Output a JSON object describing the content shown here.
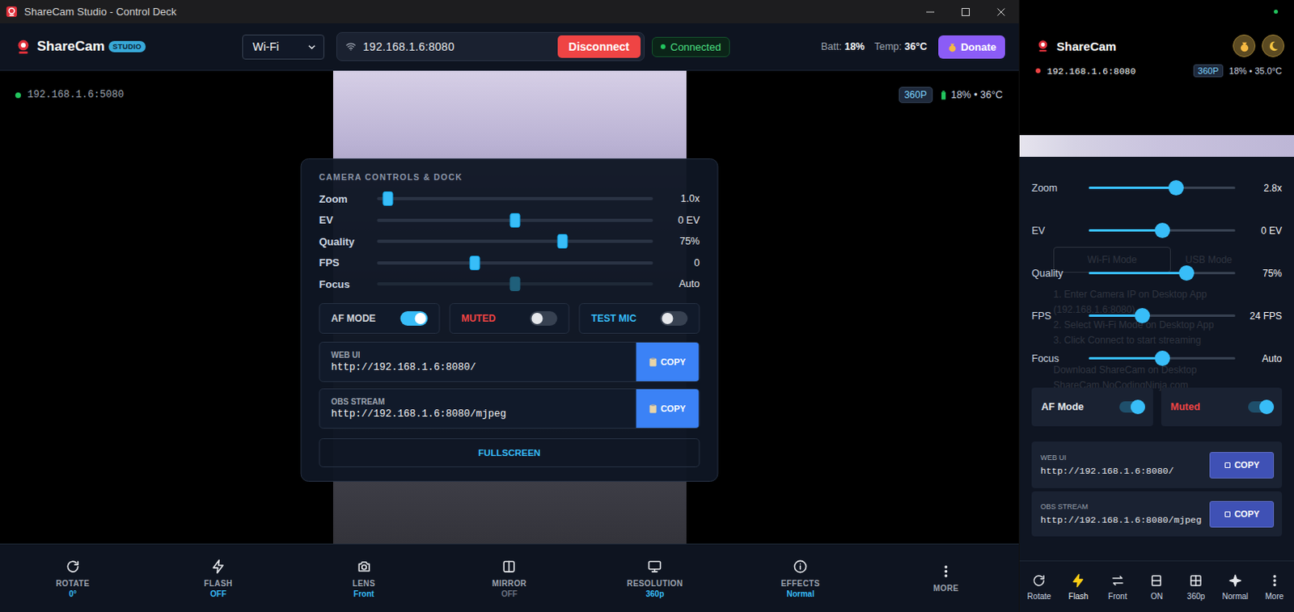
{
  "window": {
    "title": "ShareCam Studio - Control Deck"
  },
  "header": {
    "brand": "ShareCam",
    "badge": "STUDIO",
    "connection_type": "Wi-Fi",
    "address": "192.168.1.6:8080",
    "disconnect": "Disconnect",
    "status": "Connected",
    "battery_label": "Batt:",
    "battery": "18%",
    "temp_label": "Temp:",
    "temp": "36°C",
    "donate": "Donate"
  },
  "preview": {
    "source": "192.168.1.6:5080",
    "resolution": "360P",
    "stats": "18% • 36°C"
  },
  "controls_panel": {
    "title": "CAMERA CONTROLS & DOCK",
    "sliders": [
      {
        "label": "Zoom",
        "level": 0.02,
        "reading": "1.0x",
        "disabled": false
      },
      {
        "label": "EV",
        "level": 0.5,
        "reading": "0 EV",
        "disabled": false
      },
      {
        "label": "Quality",
        "level": 0.68,
        "reading": "75%",
        "disabled": false
      },
      {
        "label": "FPS",
        "level": 0.35,
        "reading": "0",
        "disabled": false
      },
      {
        "label": "Focus",
        "level": 0.5,
        "reading": "Auto",
        "disabled": true
      }
    ],
    "toggles": [
      {
        "label": "AF MODE",
        "on": true,
        "color": "#d1d5db"
      },
      {
        "label": "MUTED",
        "on": false,
        "color": "#ef4444"
      },
      {
        "label": "TEST MIC",
        "on": false,
        "color": "#38bdf8"
      }
    ],
    "links": [
      {
        "label": "WEB UI",
        "url": "http://192.168.1.6:8080/",
        "button": "COPY"
      },
      {
        "label": "OBS STREAM",
        "url": "http://192.168.1.6:8080/mjpeg",
        "button": "COPY"
      }
    ],
    "fullscreen": "FULLSCREEN"
  },
  "toolbar": [
    {
      "label": "ROTATE",
      "value": "0°",
      "highlighted": true
    },
    {
      "label": "FLASH",
      "value": "OFF",
      "highlighted": true
    },
    {
      "label": "LENS",
      "value": "Front",
      "highlighted": true
    },
    {
      "label": "MIRROR",
      "value": "OFF",
      "highlighted": false
    },
    {
      "label": "RESOLUTION",
      "value": "360p",
      "highlighted": true
    },
    {
      "label": "EFFECTS",
      "value": "Normal",
      "highlighted": true
    },
    {
      "label": "MORE"
    }
  ],
  "phone": {
    "brand": "ShareCam",
    "address": "192.168.1.6:8080",
    "resolution": "360P",
    "stats": "18% • 35.0°C",
    "background_hint": {
      "modes": [
        "Wi-Fi Mode",
        "USB Mode"
      ],
      "steps": [
        "1. Enter Camera IP on Desktop App",
        "(192.168.1.6:8080)",
        "2. Select Wi-Fi Mode on Desktop App",
        "3. Click Connect to start streaming"
      ],
      "footer": [
        "Download ShareCam on Desktop",
        "ShareCam.NoCodingNinja.com"
      ]
    },
    "sliders": [
      {
        "label": "Zoom",
        "level": 0.61,
        "reading": "2.8x"
      },
      {
        "label": "EV",
        "level": 0.5,
        "reading": "0 EV"
      },
      {
        "label": "Quality",
        "level": 0.69,
        "reading": "75%"
      },
      {
        "label": "FPS",
        "level": 0.35,
        "reading": "24 FPS"
      },
      {
        "label": "Focus",
        "level": 0.5,
        "reading": "Auto"
      }
    ],
    "toggles": [
      {
        "label": "AF Mode",
        "on": true,
        "color": "#e5e7eb"
      },
      {
        "label": "Muted",
        "on": true,
        "color": "#ef4444"
      }
    ],
    "links": [
      {
        "label": "WEB UI",
        "url": "http://192.168.1.6:8080/",
        "button": "COPY"
      },
      {
        "label": "OBS STREAM",
        "url": "http://192.168.1.6:8080/mjpeg",
        "button": "COPY"
      }
    ],
    "nav": [
      {
        "label": "Rotate",
        "active": false
      },
      {
        "label": "Flash",
        "active": true
      },
      {
        "label": "Front",
        "active": false
      },
      {
        "label": "ON",
        "active": false
      },
      {
        "label": "360p",
        "active": false
      },
      {
        "label": "Normal",
        "active": false
      },
      {
        "label": "More",
        "active": false
      }
    ]
  }
}
